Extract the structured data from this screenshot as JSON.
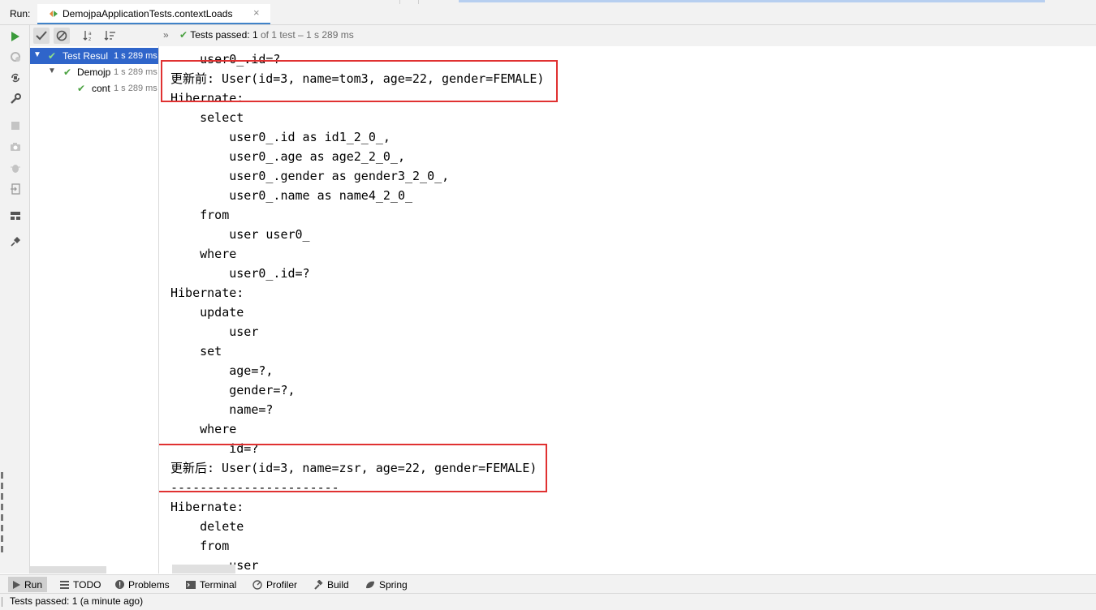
{
  "header": {
    "run_label": "Run:",
    "tab_title": "DemojpaApplicationTests.contextLoads",
    "tab_close": "×"
  },
  "test_status": {
    "chevron": "»",
    "label": "Tests passed:",
    "count": "1",
    "detail": "of 1 test – 1 s 289 ms"
  },
  "tree": {
    "items": [
      {
        "label": "Test Resul",
        "time": "1 s 289 ms"
      },
      {
        "label": "Demojp",
        "time": "1 s 289 ms"
      },
      {
        "label": "cont",
        "time": "1 s 289 ms"
      }
    ]
  },
  "console": {
    "lines": [
      "    user0_.id=?",
      "更新前: User(id=3, name=tom3, age=22, gender=FEMALE)",
      "Hibernate:",
      "    select",
      "        user0_.id as id1_2_0_,",
      "        user0_.age as age2_2_0_,",
      "        user0_.gender as gender3_2_0_,",
      "        user0_.name as name4_2_0_",
      "    from",
      "        user user0_",
      "    where",
      "        user0_.id=?",
      "Hibernate:",
      "    update",
      "        user",
      "    set",
      "        age=?,",
      "        gender=?,",
      "        name=?",
      "    where",
      "        id=?",
      "更新后: User(id=3, name=zsr, age=22, gender=FEMALE)",
      "-----------------------",
      "Hibernate:",
      "    delete",
      "    from",
      "        user"
    ]
  },
  "bottom_tabs": {
    "run": "Run",
    "todo": "TODO",
    "problems": "Problems",
    "terminal": "Terminal",
    "profiler": "Profiler",
    "build": "Build",
    "spring": "Spring"
  },
  "status_bar": {
    "message": "Tests passed: 1 (a minute ago)"
  },
  "colors": {
    "accent": "#2f65ca",
    "pass_green": "#4aa140",
    "highlight_red": "#e03131"
  }
}
